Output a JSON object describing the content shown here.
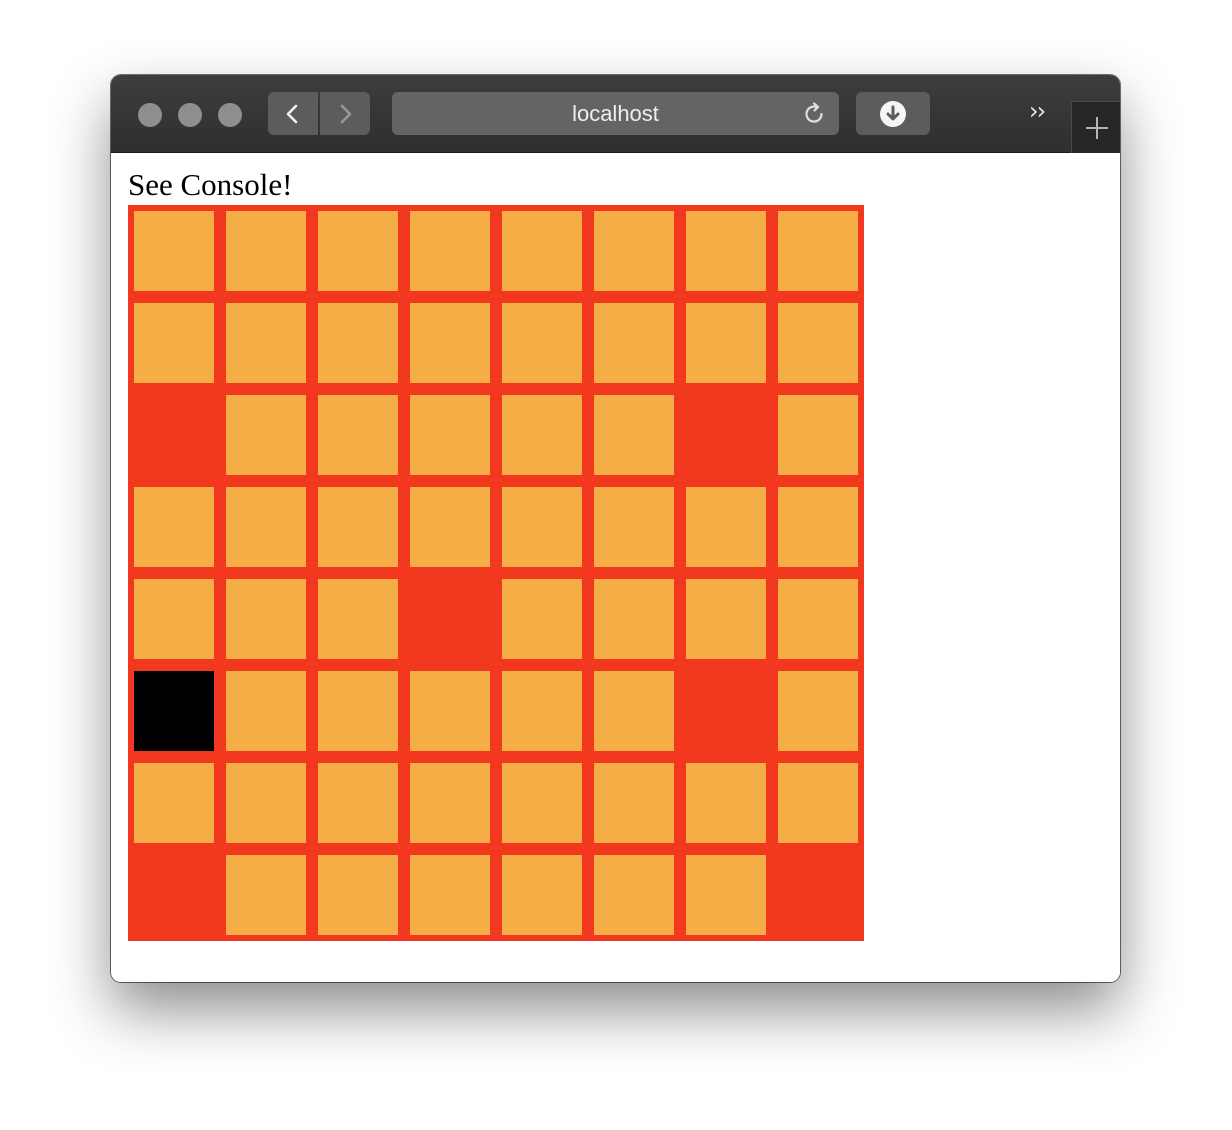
{
  "browser": {
    "address": "localhost",
    "icons": {
      "back": "chevron-left-icon",
      "forward": "chevron-right-icon",
      "reload": "reload-icon",
      "download": "download-icon",
      "overflow": "double-chevron-right-icon",
      "new_tab": "plus-icon"
    }
  },
  "page": {
    "heading": "See Console!"
  },
  "board": {
    "rows": 8,
    "cols": 8,
    "colors": {
      "empty": "#f5ad45",
      "red": "#f33820",
      "black": "#000000"
    },
    "cells": [
      [
        "empty",
        "empty",
        "empty",
        "empty",
        "empty",
        "empty",
        "empty",
        "empty"
      ],
      [
        "empty",
        "empty",
        "empty",
        "empty",
        "empty",
        "empty",
        "empty",
        "empty"
      ],
      [
        "red",
        "empty",
        "empty",
        "empty",
        "empty",
        "empty",
        "red",
        "empty"
      ],
      [
        "empty",
        "empty",
        "empty",
        "empty",
        "empty",
        "empty",
        "empty",
        "empty"
      ],
      [
        "empty",
        "empty",
        "empty",
        "red",
        "empty",
        "empty",
        "empty",
        "empty"
      ],
      [
        "black",
        "empty",
        "empty",
        "empty",
        "empty",
        "empty",
        "red",
        "empty"
      ],
      [
        "empty",
        "empty",
        "empty",
        "empty",
        "empty",
        "empty",
        "empty",
        "empty"
      ],
      [
        "red",
        "empty",
        "empty",
        "empty",
        "empty",
        "empty",
        "empty",
        "red"
      ]
    ]
  }
}
